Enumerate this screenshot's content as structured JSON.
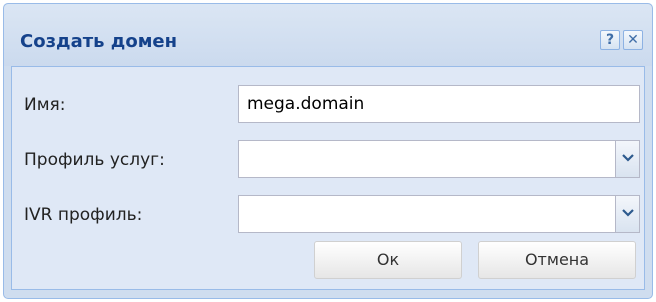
{
  "dialog": {
    "title": "Создать домен",
    "tools": {
      "help_glyph": "?",
      "help_icon": "help-icon",
      "close_glyph": "✕",
      "close_icon": "close-icon"
    }
  },
  "form": {
    "name": {
      "label": "Имя:",
      "value": "mega.domain"
    },
    "service_profile": {
      "label": "Профиль услуг:",
      "value": ""
    },
    "ivr_profile": {
      "label": "IVR профиль:",
      "value": ""
    }
  },
  "buttons": {
    "ok": "Ок",
    "cancel": "Отмена"
  },
  "colors": {
    "title_text": "#15428b",
    "frame_border": "#99bbe8",
    "body_background": "#dfe8f6",
    "trigger_arrow": "#2d5a8e"
  }
}
